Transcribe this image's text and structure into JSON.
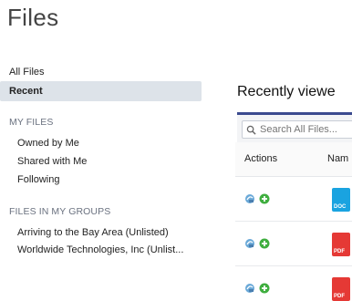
{
  "page": {
    "title": "Files"
  },
  "sidebar": {
    "all_files": "All Files",
    "recent": "Recent",
    "my_files_header": "MY FILES",
    "my_files": [
      "Owned by Me",
      "Shared with Me",
      "Following"
    ],
    "groups_header": "FILES IN MY GROUPS",
    "groups": [
      "Arriving to the Bay Area (Unlisted)",
      "Worldwide Technologies, Inc (Unlist..."
    ]
  },
  "main": {
    "title": "Recently viewe",
    "search": {
      "placeholder": "Search All Files..."
    },
    "table": {
      "headers": {
        "actions": "Actions",
        "name": "Nam"
      },
      "rows": [
        {
          "file_type": "DOC",
          "color": "#1aa3e0"
        },
        {
          "file_type": "PDF",
          "color": "#e53935"
        },
        {
          "file_type": "PDF",
          "color": "#e53935"
        }
      ]
    }
  }
}
